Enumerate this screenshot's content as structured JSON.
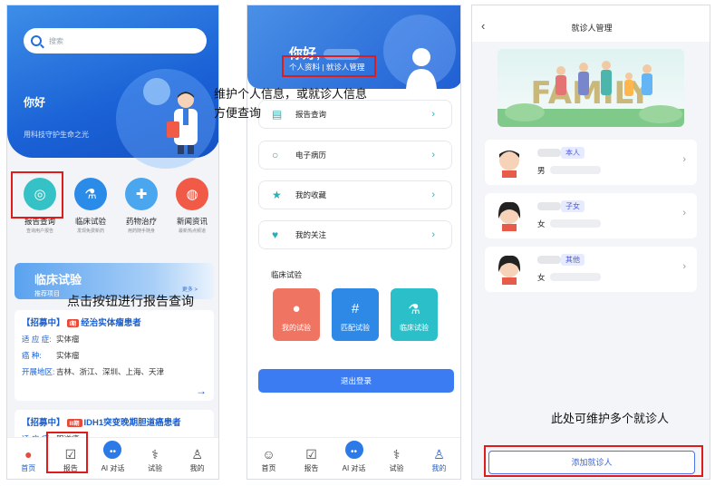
{
  "home": {
    "search_placeholder": "搜索",
    "greeting": "你好",
    "slogan": "用科技守护生命之光",
    "icons": [
      {
        "label": "报告查询",
        "sub": "查询用户报告",
        "color": "#35c2c6",
        "glyph": "◎"
      },
      {
        "label": "临床试验",
        "sub": "发现免费新药",
        "color": "#2b8be8",
        "glyph": "⚗"
      },
      {
        "label": "药物治疗",
        "sub": "用药随手随身",
        "color": "#4aa6ee",
        "glyph": "✚"
      },
      {
        "label": "新闻资讯",
        "sub": "最新热点频道",
        "color": "#f05a47",
        "glyph": "◍"
      }
    ],
    "banner": {
      "title": "临床试验",
      "subtitle": "推荐项目",
      "more": "更多 >"
    },
    "trials": [
      {
        "status": "【招募中】",
        "phase": "I期",
        "title": "经治实体瘤患者",
        "rows": [
          {
            "k": "适 应 症:",
            "v": "实体瘤"
          },
          {
            "k": "癌    种:",
            "v": "实体瘤"
          },
          {
            "k": "开展地区:",
            "v": "吉林、浙江、深圳、上海、天津"
          }
        ]
      },
      {
        "status": "【招募中】",
        "phase": "III期",
        "title": "IDH1突变晚期胆道癌患者",
        "rows": [
          {
            "k": "适 应 症:",
            "v": "胆道癌"
          }
        ]
      }
    ]
  },
  "tabs": [
    "首页",
    "报告",
    "AI 对话",
    "试验",
    "我的"
  ],
  "profile": {
    "greeting": "你好,",
    "links": "个人资料 | 就诊人管理",
    "menu": [
      "报告查询",
      "电子病历",
      "我的收藏",
      "我的关注"
    ],
    "section": "临床试验",
    "tiles": [
      {
        "label": "我的试验",
        "color": "#f07462"
      },
      {
        "label": "匹配试验",
        "color": "#2e88e6"
      },
      {
        "label": "临床试验",
        "color": "#2bc0c9"
      }
    ],
    "logout": "退出登录"
  },
  "patients": {
    "title": "就诊人管理",
    "banner_text": "FAMILY",
    "list": [
      {
        "relation": "本人",
        "sex": "男"
      },
      {
        "relation": "子女",
        "sex": "女"
      },
      {
        "relation": "其他",
        "sex": "女"
      }
    ],
    "add_button": "添加就诊人"
  },
  "annotations": {
    "a1_line1": "维护个人信息，或就诊人信息",
    "a1_line2": "方便查询",
    "a2": "点击按钮进行报告查询",
    "a3": "此处可维护多个就诊人"
  },
  "colors": {
    "primary": "#1a5fd0",
    "highlight": "#e01b1b"
  }
}
